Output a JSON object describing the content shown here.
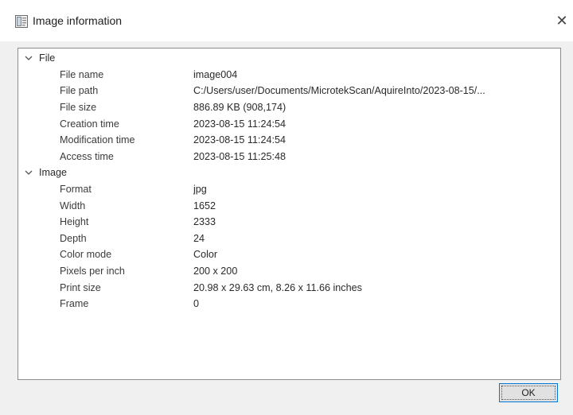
{
  "window": {
    "title": "Image information",
    "close_glyph": "✕"
  },
  "groups": [
    {
      "label": "File",
      "items": [
        {
          "key": "File name",
          "value": "image004"
        },
        {
          "key": "File path",
          "value": "C:/Users/user/Documents/MicrotekScan/AquireInto/2023-08-15/..."
        },
        {
          "key": "File size",
          "value": "886.89 KB (908,174)"
        },
        {
          "key": "Creation time",
          "value": "2023-08-15 11:24:54"
        },
        {
          "key": "Modification time",
          "value": "2023-08-15 11:24:54"
        },
        {
          "key": "Access time",
          "value": "2023-08-15 11:25:48"
        }
      ]
    },
    {
      "label": "Image",
      "items": [
        {
          "key": "Format",
          "value": "jpg"
        },
        {
          "key": "Width",
          "value": "1652"
        },
        {
          "key": "Height",
          "value": "2333"
        },
        {
          "key": "Depth",
          "value": "24"
        },
        {
          "key": "Color mode",
          "value": "Color"
        },
        {
          "key": "Pixels per inch",
          "value": "200 x 200"
        },
        {
          "key": "Print size",
          "value": "20.98 x 29.63 cm, 8.26 x 11.66 inches"
        },
        {
          "key": "Frame",
          "value": "0"
        }
      ]
    }
  ],
  "footer": {
    "ok_label": "OK"
  },
  "icons": {
    "app": "image-info-app-icon",
    "close": "close-icon",
    "expand": "chevron-down-icon"
  },
  "colors": {
    "accent": "#0078d7",
    "panel_border": "#8c8c8c",
    "window_bg": "#f0f0f0"
  }
}
